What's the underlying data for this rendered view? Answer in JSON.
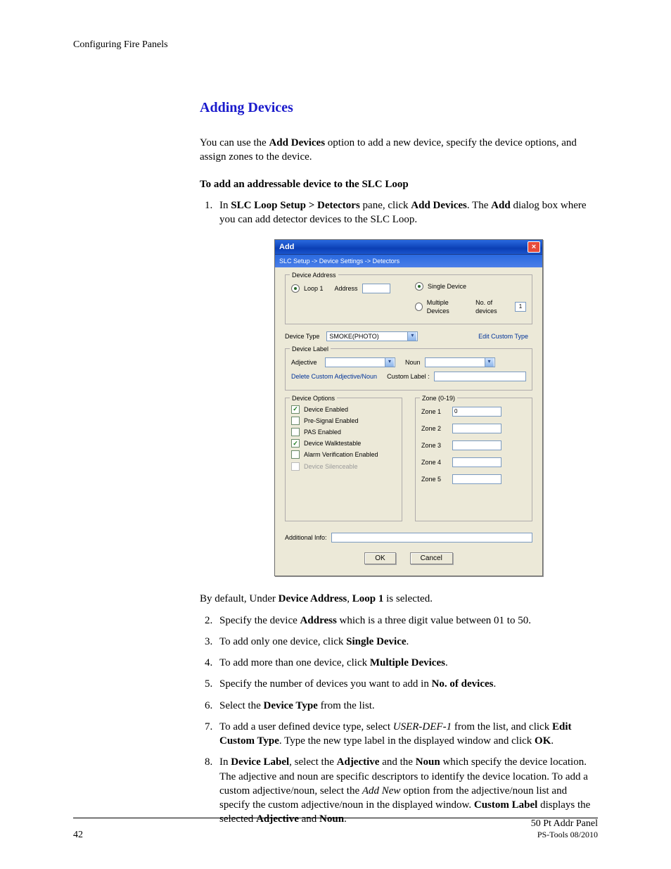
{
  "header": {
    "running": "Configuring Fire Panels"
  },
  "section": {
    "title": "Adding Devices",
    "intro_a": "You can use the ",
    "intro_b": "Add Devices",
    "intro_c": " option to add a new device, specify the device options, and assign zones to the device.",
    "subhead": "To add an addressable device to the SLC Loop"
  },
  "step1": {
    "a": "In ",
    "b": "SLC Loop Setup > Detectors",
    "c": " pane, click ",
    "d": "Add Devices",
    "e": ". The ",
    "f": "Add",
    "g": " dialog box where you can add detector devices to the SLC Loop."
  },
  "default_line": {
    "a": "By default, Under ",
    "b": "Device Address",
    "c": ", ",
    "d": "Loop 1",
    "e": " is selected."
  },
  "step2": {
    "a": "Specify the device ",
    "b": "Address",
    "c": " which is a three digit value between 01 to 50."
  },
  "step3": {
    "a": "To add only one device, click ",
    "b": "Single Device",
    "c": "."
  },
  "step4": {
    "a": "To add more than one device, click ",
    "b": "Multiple Devices",
    "c": "."
  },
  "step5": {
    "a": "Specify the number of devices you want to add in ",
    "b": "No. of devices",
    "c": "."
  },
  "step6": {
    "a": "Select the ",
    "b": "Device Type",
    "c": " from the list."
  },
  "step7": {
    "a": "To add a user defined device type, select ",
    "b": "USER-DEF-1",
    "c": " from the list, and click ",
    "d": "Edit Custom Type",
    "e": ". Type the new type label in the displayed window and click ",
    "f": "OK",
    "g": "."
  },
  "step8": {
    "a": "In ",
    "b": "Device Label",
    "c": ", select the ",
    "d": "Adjective",
    "e": " and the ",
    "f": "Noun",
    "g": " which specify the device location. The adjective and noun are specific descriptors to identify the device location. To add a custom adjective/noun, select the ",
    "h": "Add New",
    "i": " option from the adjective/noun list and specify the custom adjective/noun in the displayed window. ",
    "j": "Custom Label",
    "k": " displays the selected ",
    "l": "Adjective",
    "m": " and ",
    "n": "Noun",
    "o": "."
  },
  "dialog": {
    "title": "Add",
    "breadcrumb": "SLC Setup -> Device Settings -> Detectors",
    "addr_legend": "Device Address",
    "loop1": "Loop 1",
    "address_lbl": "Address",
    "single": "Single Device",
    "multiple": "Multiple Devices",
    "no_devices_lbl": "No. of devices",
    "no_devices_val": "1",
    "device_type_lbl": "Device Type",
    "device_type_val": "SMOKE(PHOTO)",
    "edit_custom": "Edit Custom Type",
    "label_legend": "Device Label",
    "adjective_lbl": "Adjective",
    "noun_lbl": "Noun",
    "delete_custom": "Delete Custom Adjective/Noun",
    "custom_label_lbl": "Custom Label :",
    "options_legend": "Device Options",
    "opt1": "Device Enabled",
    "opt2": "Pre-Signal Enabled",
    "opt3": "PAS Enabled",
    "opt4": "Device Walktestable",
    "opt5": "Alarm Verification Enabled",
    "opt6": "Device Silenceable",
    "zone_legend": "Zone (0-19)",
    "zone1": "Zone 1",
    "zone1_val": "0",
    "zone2": "Zone 2",
    "zone3": "Zone 3",
    "zone4": "Zone 4",
    "zone5": "Zone 5",
    "addl_info": "Additional Info:",
    "ok": "OK",
    "cancel": "Cancel"
  },
  "footer": {
    "page": "42",
    "right1": "50 Pt Addr Panel",
    "right2": "PS-Tools 08/2010"
  }
}
